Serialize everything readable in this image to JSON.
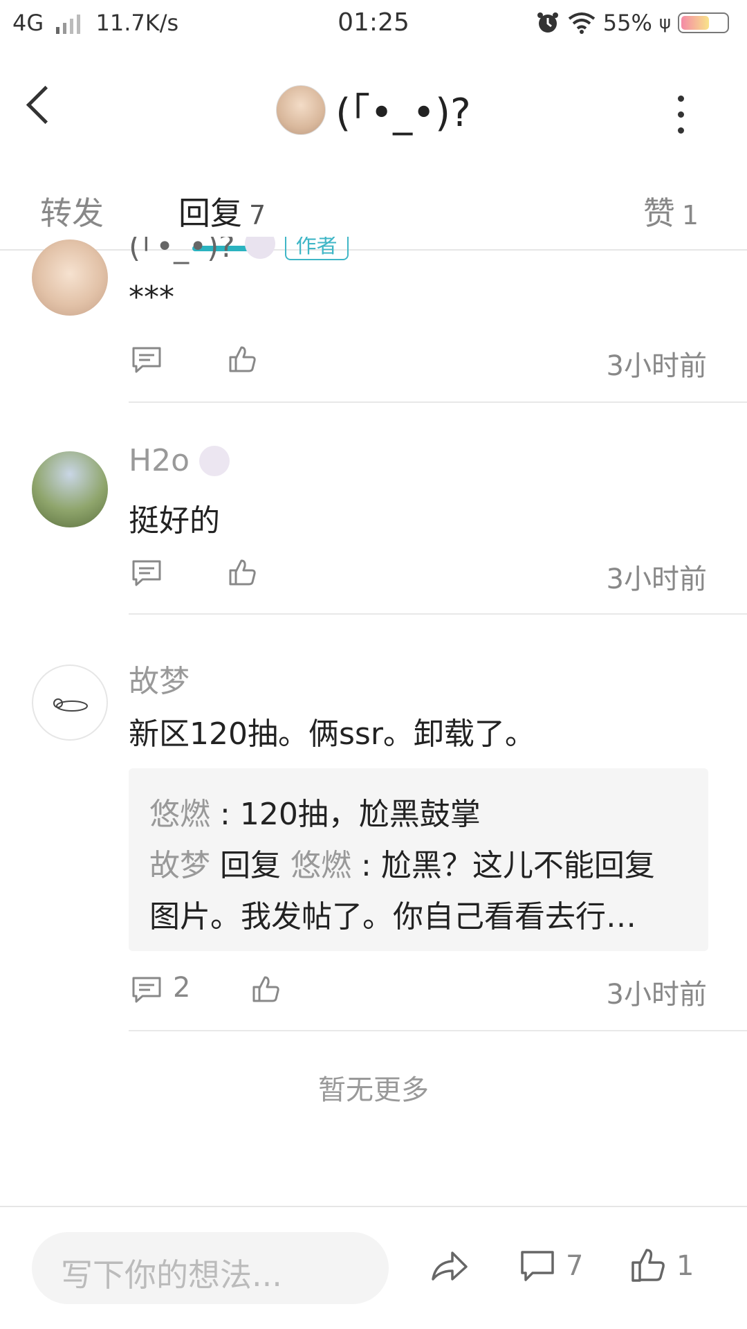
{
  "status_bar": {
    "network": "4G",
    "speed": "11.7K/s",
    "time": "01:25",
    "battery": "55%"
  },
  "header": {
    "title": "(｢•_•)?"
  },
  "tabs": {
    "repost": {
      "label": "转发"
    },
    "reply": {
      "label": "回复",
      "count": "7"
    },
    "like": {
      "label": "赞",
      "count": "1"
    }
  },
  "comments": [
    {
      "author": "(｢•_•)?",
      "badge": "作者",
      "text": "***",
      "time": "3小时前"
    },
    {
      "author": "H2o",
      "text": "挺好的",
      "time": "3小时前"
    },
    {
      "author": "故梦",
      "text": "新区120抽。俩ssr。卸载了。",
      "replies": [
        {
          "name": "悠燃",
          "sep": ":",
          "text": "120抽，尬黑鼓掌"
        },
        {
          "name": "故梦",
          "reply_word": "回复",
          "to": "悠燃",
          "sep": ":",
          "text": "尬黑？这儿不能回复",
          "text2": "图片。我发帖了。你自己看看去行…"
        }
      ],
      "reply_count": "2",
      "time": "3小时前"
    }
  ],
  "end_note": "暂无更多",
  "bottom_bar": {
    "input_placeholder": "写下你的想法...",
    "comment_count": "7",
    "like_count": "1"
  }
}
